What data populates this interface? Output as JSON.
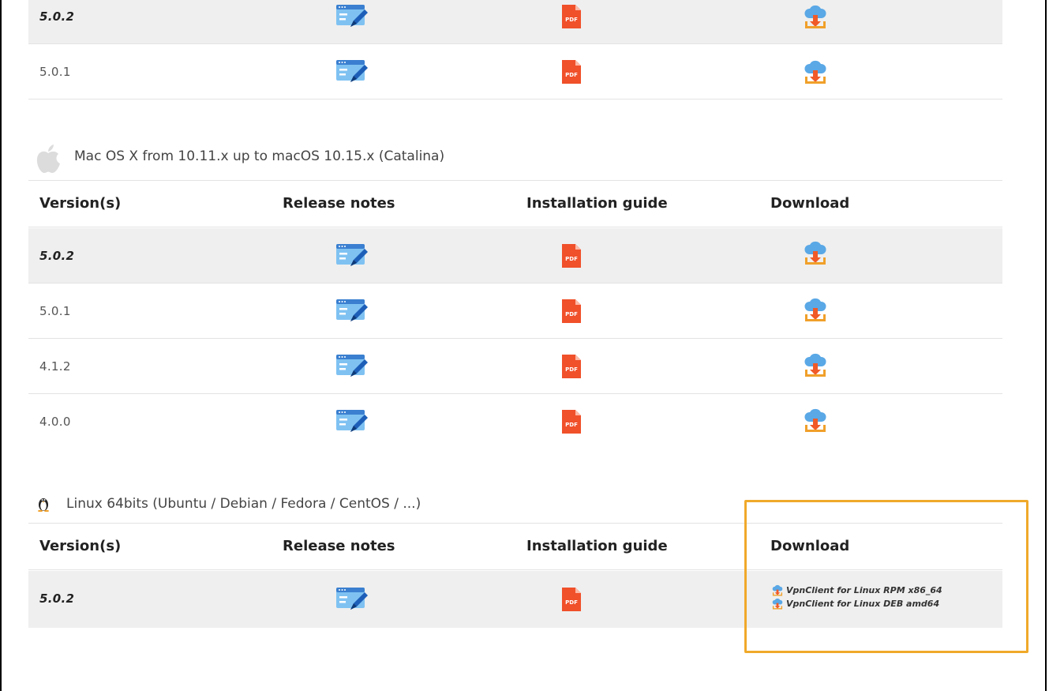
{
  "top_table": {
    "rows": [
      {
        "version": "5.0.2",
        "bold": true
      },
      {
        "version": "5.0.1",
        "bold": false
      }
    ]
  },
  "mac": {
    "title": "Mac OS X from 10.11.x up to macOS 10.15.x (Catalina)",
    "headers": {
      "version": "Version(s)",
      "notes": "Release notes",
      "guide": "Installation guide",
      "download": "Download"
    },
    "rows": [
      {
        "version": "5.0.2",
        "bold": true
      },
      {
        "version": "5.0.1",
        "bold": false
      },
      {
        "version": "4.1.2",
        "bold": false
      },
      {
        "version": "4.0.0",
        "bold": false
      }
    ]
  },
  "linux": {
    "title": "Linux 64bits (Ubuntu / Debian / Fedora / CentOS / ...)",
    "headers": {
      "version": "Version(s)",
      "notes": "Release notes",
      "guide": "Installation guide",
      "download": "Download"
    },
    "rows": [
      {
        "version": "5.0.2",
        "bold": true
      }
    ],
    "downloads": [
      {
        "label": "VpnClient for Linux RPM x86_64"
      },
      {
        "label": "VpnClient for Linux DEB amd64"
      }
    ]
  },
  "icons": {
    "release_notes": "release-notes-icon",
    "pdf": "pdf-icon",
    "download": "cloud-download-icon",
    "apple": "apple-icon",
    "linux": "linux-penguin-icon"
  },
  "colors": {
    "row_shade": "#efefef",
    "pdf_red": "#f0502a",
    "notes_blue": "#3a8fe0",
    "cloud_blue": "#5aa8e6",
    "download_orange": "#f07e26",
    "highlight": "#f0a92a"
  }
}
